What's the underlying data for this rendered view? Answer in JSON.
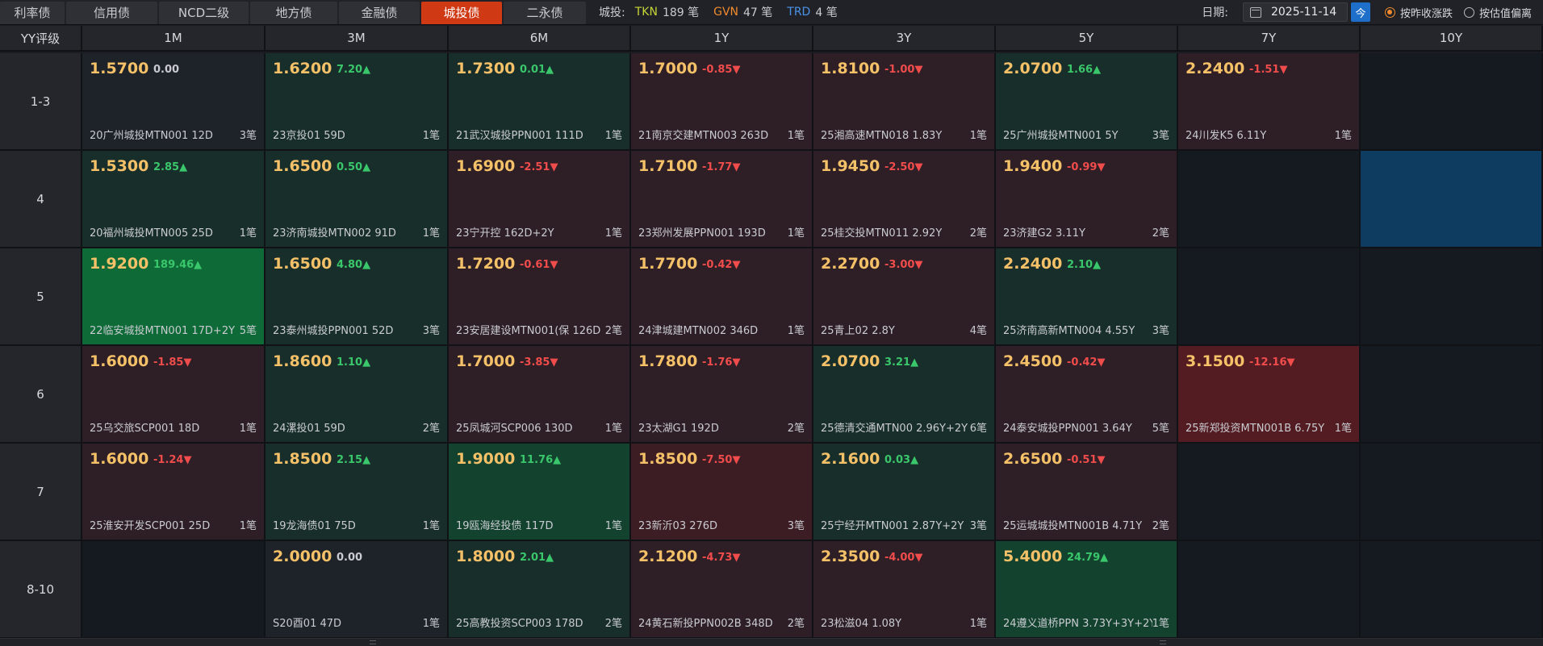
{
  "tabs": [
    "利率债",
    "信用债",
    "NCD二级",
    "地方债",
    "金融债",
    "城投债",
    "二永债"
  ],
  "active_tab": 5,
  "summary": {
    "label": "城投:",
    "items": [
      {
        "code": "TKN",
        "count": "189 笔",
        "color": "#c6d437"
      },
      {
        "code": "GVN",
        "count": "47 笔",
        "color": "#f08a2c"
      },
      {
        "code": "TRD",
        "count": "4 笔",
        "color": "#4b93e8"
      }
    ]
  },
  "date": {
    "label": "日期:",
    "value": "2025-11-14",
    "today_label": "今"
  },
  "radios": [
    {
      "label": "按昨收涨跌",
      "checked": true
    },
    {
      "label": "按估值偏离",
      "checked": false
    }
  ],
  "header": {
    "corner": "YY评级",
    "tenors": [
      "1M",
      "3M",
      "6M",
      "1Y",
      "3Y",
      "5Y",
      "7Y",
      "10Y"
    ]
  },
  "rows": [
    {
      "rating": "1-3",
      "cells": [
        {
          "yield": "1.5700",
          "change": "0.00",
          "dir": "flat",
          "bond": "20广州城投MTN001 12D",
          "count": "3笔",
          "tone": "flat"
        },
        {
          "yield": "1.6200",
          "change": "7.20▲",
          "dir": "up",
          "bond": "23京投01 59D",
          "count": "1笔",
          "tone": "up"
        },
        {
          "yield": "1.7300",
          "change": "0.01▲",
          "dir": "up",
          "bond": "21武汉城投PPN001 111D",
          "count": "1笔",
          "tone": "up"
        },
        {
          "yield": "1.7000",
          "change": "-0.85▼",
          "dir": "down",
          "bond": "21南京交建MTN003 263D",
          "count": "1笔",
          "tone": "down"
        },
        {
          "yield": "1.8100",
          "change": "-1.00▼",
          "dir": "down",
          "bond": "25湘高速MTN018 1.83Y",
          "count": "1笔",
          "tone": "down"
        },
        {
          "yield": "2.0700",
          "change": "1.66▲",
          "dir": "up",
          "bond": "25广州城投MTN001 5Y",
          "count": "3笔",
          "tone": "up"
        },
        {
          "yield": "2.2400",
          "change": "-1.51▼",
          "dir": "down",
          "bond": "24川发K5 6.11Y",
          "count": "1笔",
          "tone": "down"
        },
        null
      ]
    },
    {
      "rating": "4",
      "cells": [
        {
          "yield": "1.5300",
          "change": "2.85▲",
          "dir": "up",
          "bond": "20福州城投MTN005 25D",
          "count": "1笔",
          "tone": "up"
        },
        {
          "yield": "1.6500",
          "change": "0.50▲",
          "dir": "up",
          "bond": "23济南城投MTN002 91D",
          "count": "1笔",
          "tone": "up"
        },
        {
          "yield": "1.6900",
          "change": "-2.51▼",
          "dir": "down",
          "bond": "23宁开控 162D+2Y",
          "count": "1笔",
          "tone": "down"
        },
        {
          "yield": "1.7100",
          "change": "-1.77▼",
          "dir": "down",
          "bond": "23郑州发展PPN001 193D",
          "count": "1笔",
          "tone": "down"
        },
        {
          "yield": "1.9450",
          "change": "-2.50▼",
          "dir": "down",
          "bond": "25桂交投MTN011 2.92Y",
          "count": "2笔",
          "tone": "down"
        },
        {
          "yield": "1.9400",
          "change": "-0.99▼",
          "dir": "down",
          "bond": "23济建G2 3.11Y",
          "count": "2笔",
          "tone": "down"
        },
        null,
        {
          "blank": true
        }
      ]
    },
    {
      "rating": "5",
      "cells": [
        {
          "yield": "1.9200",
          "change": "189.46▲",
          "dir": "up",
          "bond": "22临安城投MTN001 17D+2Y",
          "count": "5笔",
          "tone": "strongup"
        },
        {
          "yield": "1.6500",
          "change": "4.80▲",
          "dir": "up",
          "bond": "23泰州城投PPN001 52D",
          "count": "3笔",
          "tone": "up"
        },
        {
          "yield": "1.7200",
          "change": "-0.61▼",
          "dir": "down",
          "bond": "23安居建设MTN001(保 126D",
          "count": "2笔",
          "tone": "down"
        },
        {
          "yield": "1.7700",
          "change": "-0.42▼",
          "dir": "down",
          "bond": "24津城建MTN002 346D",
          "count": "1笔",
          "tone": "down"
        },
        {
          "yield": "2.2700",
          "change": "-3.00▼",
          "dir": "down",
          "bond": "25青上02 2.8Y",
          "count": "4笔",
          "tone": "down"
        },
        {
          "yield": "2.2400",
          "change": "2.10▲",
          "dir": "up",
          "bond": "25济南高新MTN004 4.55Y",
          "count": "3笔",
          "tone": "up"
        },
        null,
        null
      ]
    },
    {
      "rating": "6",
      "cells": [
        {
          "yield": "1.6000",
          "change": "-1.85▼",
          "dir": "down",
          "bond": "25乌交旅SCP001 18D",
          "count": "1笔",
          "tone": "down"
        },
        {
          "yield": "1.8600",
          "change": "1.10▲",
          "dir": "up",
          "bond": "24漯投01 59D",
          "count": "2笔",
          "tone": "up"
        },
        {
          "yield": "1.7000",
          "change": "-3.85▼",
          "dir": "down",
          "bond": "25凤城河SCP006 130D",
          "count": "1笔",
          "tone": "down"
        },
        {
          "yield": "1.7800",
          "change": "-1.76▼",
          "dir": "down",
          "bond": "23太湖G1 192D",
          "count": "2笔",
          "tone": "down"
        },
        {
          "yield": "2.0700",
          "change": "3.21▲",
          "dir": "up",
          "bond": "25德清交通MTN00 2.96Y+2Y",
          "count": "6笔",
          "tone": "up"
        },
        {
          "yield": "2.4500",
          "change": "-0.42▼",
          "dir": "down",
          "bond": "24泰安城投PPN001 3.64Y",
          "count": "5笔",
          "tone": "down"
        },
        {
          "yield": "3.1500",
          "change": "-12.16▼",
          "dir": "down",
          "bond": "25新郑投资MTN001B 6.75Y",
          "count": "1笔",
          "tone": "strongdown"
        },
        null
      ]
    },
    {
      "rating": "7",
      "cells": [
        {
          "yield": "1.6000",
          "change": "-1.24▼",
          "dir": "down",
          "bond": "25淮安开发SCP001 25D",
          "count": "1笔",
          "tone": "down"
        },
        {
          "yield": "1.8500",
          "change": "2.15▲",
          "dir": "up",
          "bond": "19龙海债01 75D",
          "count": "1笔",
          "tone": "up"
        },
        {
          "yield": "1.9000",
          "change": "11.76▲",
          "dir": "up",
          "bond": "19瓯海经投债 117D",
          "count": "1笔",
          "tone": "upmid"
        },
        {
          "yield": "1.8500",
          "change": "-7.50▼",
          "dir": "down",
          "bond": "23新沂03 276D",
          "count": "3笔",
          "tone": "downmid"
        },
        {
          "yield": "2.1600",
          "change": "0.03▲",
          "dir": "up",
          "bond": "25宁经开MTN001 2.87Y+2Y",
          "count": "3笔",
          "tone": "up"
        },
        {
          "yield": "2.6500",
          "change": "-0.51▼",
          "dir": "down",
          "bond": "25运城城投MTN001B 4.71Y",
          "count": "2笔",
          "tone": "down"
        },
        null,
        null
      ]
    },
    {
      "rating": "8-10",
      "cells": [
        {
          "empty": true
        },
        {
          "yield": "2.0000",
          "change": "0.00",
          "dir": "flat",
          "bond": "S20酉01 47D",
          "count": "1笔",
          "tone": "flat"
        },
        {
          "yield": "1.8000",
          "change": "2.01▲",
          "dir": "up",
          "bond": "25高教投资SCP003 178D",
          "count": "2笔",
          "tone": "up"
        },
        {
          "yield": "2.1200",
          "change": "-4.73▼",
          "dir": "down",
          "bond": "24黄石新投PPN002B 348D",
          "count": "2笔",
          "tone": "down"
        },
        {
          "yield": "2.3500",
          "change": "-4.00▼",
          "dir": "down",
          "bond": "23松滋04 1.08Y",
          "count": "1笔",
          "tone": "down"
        },
        {
          "yield": "5.4000",
          "change": "24.79▲",
          "dir": "up",
          "bond": "24遵义道桥PPN 3.73Y+3Y+2Y",
          "count": "1笔",
          "tone": "upmid"
        },
        null,
        null
      ]
    }
  ]
}
